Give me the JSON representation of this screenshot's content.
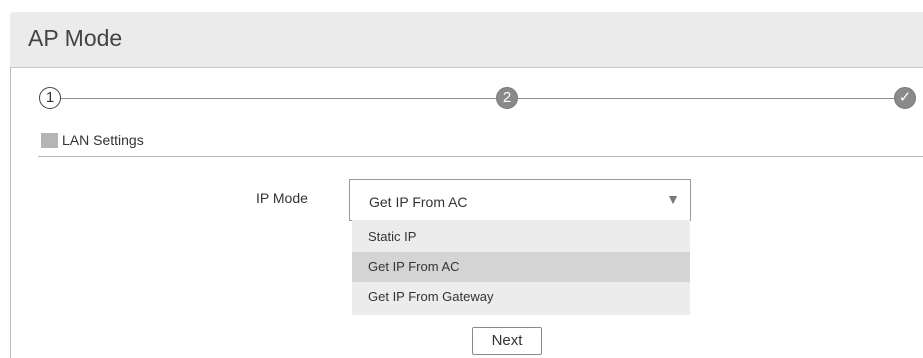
{
  "header": {
    "title": "AP Mode"
  },
  "stepper": {
    "steps": [
      {
        "label": "1",
        "state": "current"
      },
      {
        "label": "2",
        "state": "upcoming"
      },
      {
        "label": "✓",
        "state": "upcoming"
      }
    ]
  },
  "section": {
    "title": "LAN Settings"
  },
  "form": {
    "ip_mode": {
      "label": "IP Mode",
      "selected_value": "Get IP From AC",
      "arrow_icon": "triangle-down",
      "options": [
        {
          "label": "Static IP",
          "selected": false
        },
        {
          "label": "Get IP From AC",
          "selected": true
        },
        {
          "label": "Get IP From Gateway",
          "selected": false
        }
      ]
    },
    "next_label": "Next"
  },
  "colors": {
    "header_bg": "#ebebeb",
    "step_inactive": "#8a8a8a",
    "dropdown_bg": "#ececec",
    "option_highlight": "#d4d4d4"
  }
}
